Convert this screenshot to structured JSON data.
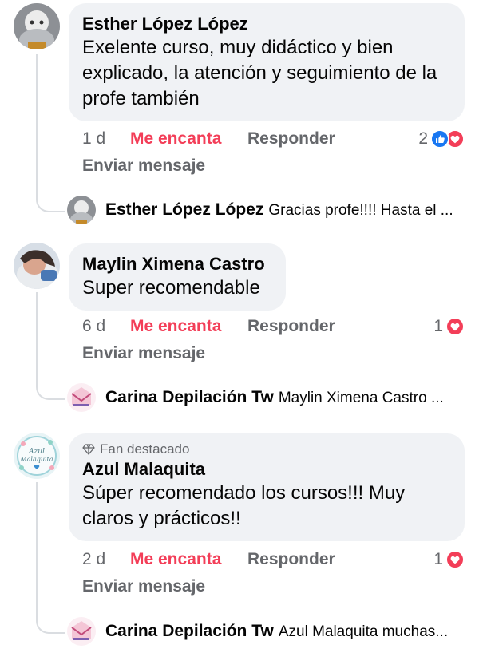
{
  "colors": {
    "accent_love": "#f33e58",
    "like_blue": "#1877f2",
    "bubble_bg": "#f0f2f5",
    "muted": "#65676b"
  },
  "comments": [
    {
      "author": "Esther López López",
      "text": "Exelente curso, muy didáctico y bien explicado, la atención y seguimiento de la profe también",
      "time": "1 d",
      "reaction_label": "Me encanta",
      "reply_label": "Responder",
      "message_label": "Enviar mensaje",
      "reaction_count": "2",
      "reaction_icons": [
        "like-icon",
        "love-icon"
      ],
      "reply_preview": {
        "author": "Esther López López",
        "text": "Gracias profe!!!! Hasta el ..."
      }
    },
    {
      "author": "Maylin Ximena Castro",
      "text": "Super recomendable",
      "time": "6 d",
      "reaction_label": "Me encanta",
      "reply_label": "Responder",
      "message_label": "Enviar mensaje",
      "reaction_count": "1",
      "reaction_icons": [
        "love-icon"
      ],
      "reply_preview": {
        "author": "Carina Depilación Tw",
        "text": "Maylin Ximena Castro ..."
      }
    },
    {
      "badge": "Fan destacado",
      "author": "Azul Malaquita",
      "avatar_text": [
        "Azul",
        "Malaquita"
      ],
      "text": "Súper recomendado los cursos!!! Muy claros y prácticos!!",
      "time": "2 d",
      "reaction_label": "Me encanta",
      "reply_label": "Responder",
      "message_label": "Enviar mensaje",
      "reaction_count": "1",
      "reaction_icons": [
        "love-icon"
      ],
      "reply_preview": {
        "author": "Carina Depilación Tw",
        "text": "Azul Malaquita muchas..."
      }
    }
  ]
}
